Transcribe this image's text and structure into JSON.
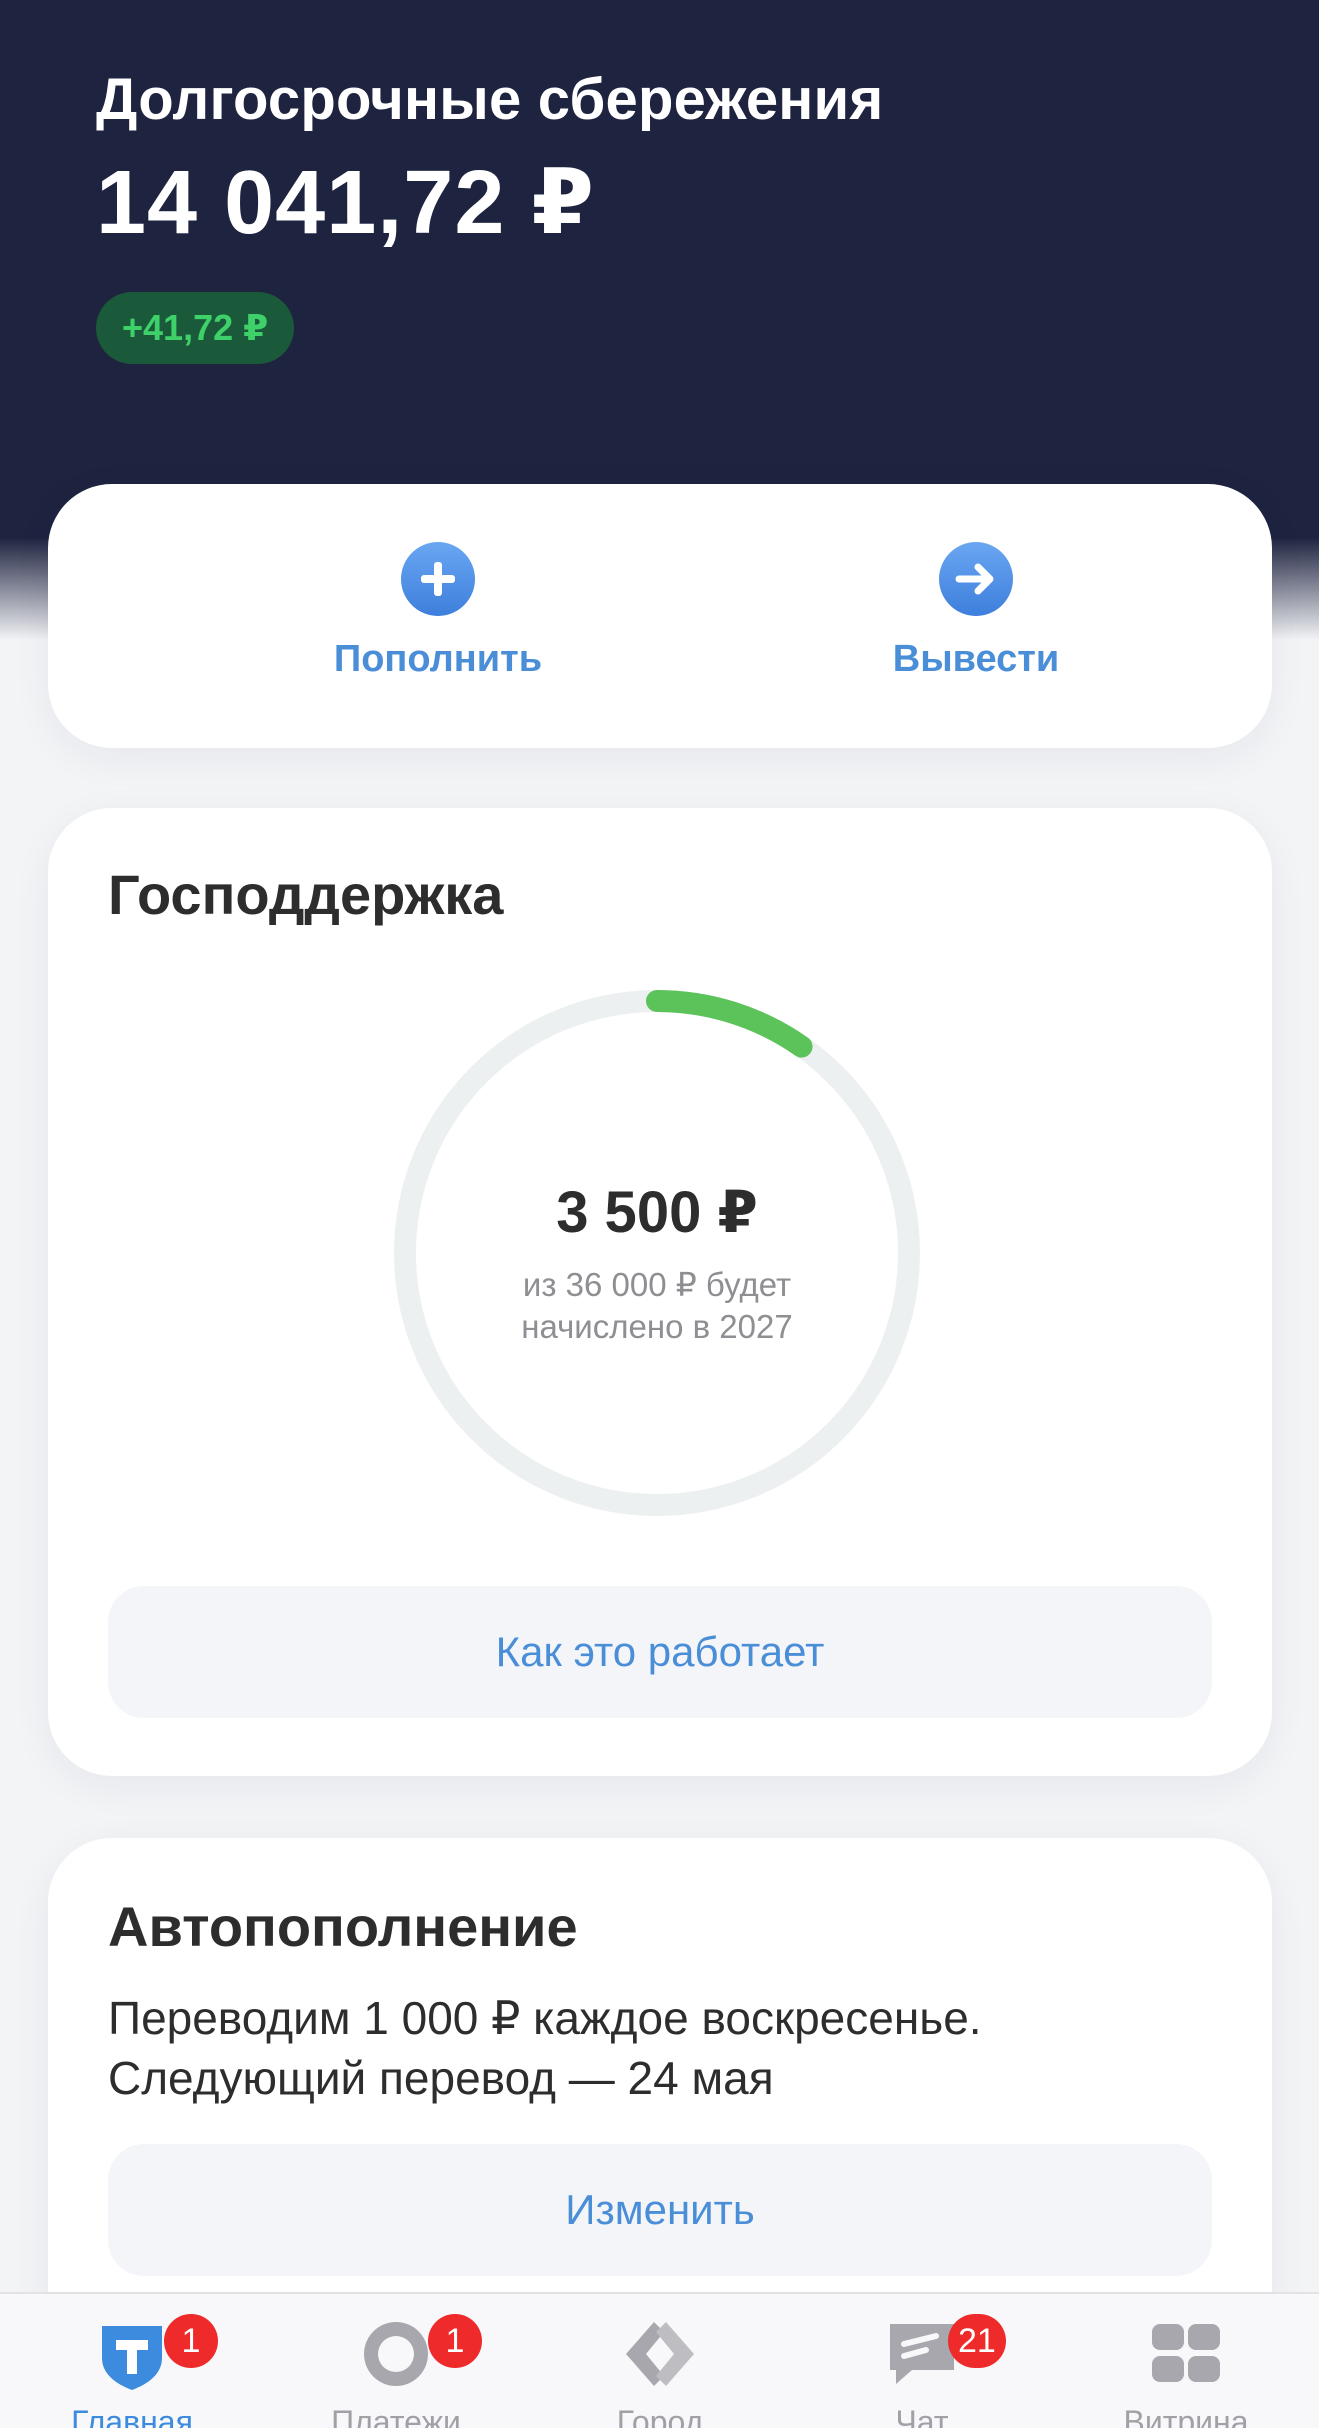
{
  "header": {
    "title": "Долгосрочные сбережения",
    "amount": "14 041,72 ₽",
    "change": "+41,72 ₽"
  },
  "actions": {
    "deposit_label": "Пополнить",
    "withdraw_label": "Вывести"
  },
  "gov_support": {
    "title": "Господдержка",
    "amount": "3 500 ₽",
    "subtitle_line1": "из 36 000 ₽ будет",
    "subtitle_line2": "начислено в 2027",
    "accrued_value": 3500,
    "total_value": 36000,
    "how_it_works_label": "Как это работает"
  },
  "auto_topup": {
    "title": "Автопополнение",
    "line1": "Переводим 1 000 ₽ каждое воскресенье.",
    "line2": "Следующий перевод — 24 мая",
    "change_label": "Изменить"
  },
  "tabbar": {
    "tabs": [
      {
        "label": "Главная",
        "icon": "home-t-shield-icon",
        "badge": "1",
        "active": true
      },
      {
        "label": "Платежи",
        "icon": "payments-icon",
        "badge": "1",
        "active": false
      },
      {
        "label": "Город",
        "icon": "city-icon",
        "badge": "",
        "active": false
      },
      {
        "label": "Чат",
        "icon": "chat-icon",
        "badge": "21",
        "active": false
      },
      {
        "label": "Витрина",
        "icon": "showcase-grid-icon",
        "badge": "",
        "active": false
      }
    ]
  },
  "colors": {
    "header_bg": "#1e2340",
    "accent_blue": "#4a8ed8",
    "progress_green": "#5cc35a",
    "badge_red": "#ee2a2a"
  }
}
